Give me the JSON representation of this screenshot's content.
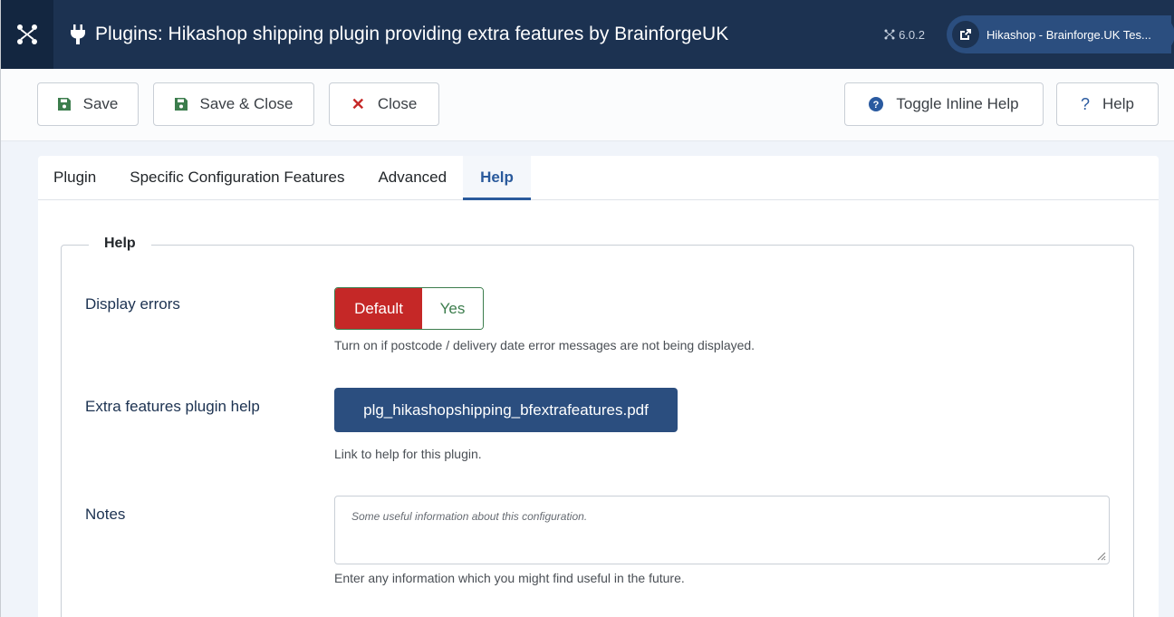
{
  "header": {
    "title": "Plugins: Hikashop shipping plugin providing extra features by BrainforgeUK",
    "version": "6.0.2",
    "site_link": "Hikashop - Brainforge.UK Tes..."
  },
  "toolbar": {
    "save_label": "Save",
    "save_close_label": "Save & Close",
    "close_label": "Close",
    "toggle_help_label": "Toggle Inline Help",
    "help_label": "Help"
  },
  "tabs": [
    {
      "label": "Plugin"
    },
    {
      "label": "Specific Configuration Features"
    },
    {
      "label": "Advanced"
    },
    {
      "label": "Help",
      "active": true
    }
  ],
  "fieldset": {
    "legend": "Help",
    "display_errors": {
      "label": "Display errors",
      "options": [
        "Default",
        "Yes"
      ],
      "selected": "Default",
      "description": "Turn on if postcode / delivery date error messages are not being displayed."
    },
    "extra_help": {
      "label": "Extra features plugin help",
      "button": "plg_hikashopshipping_bfextrafeatures.pdf",
      "description": "Link to help for this plugin."
    },
    "notes": {
      "label": "Notes",
      "placeholder": "Some useful information about this configuration.",
      "description": "Enter any information which you might find useful in the future."
    }
  },
  "colors": {
    "header_bg": "#1c3251",
    "accent": "#2b4e7f",
    "danger": "#c52827",
    "success": "#3c7d4d"
  }
}
